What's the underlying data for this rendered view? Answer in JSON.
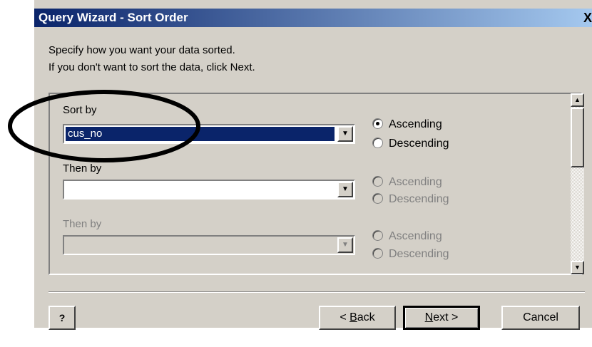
{
  "window": {
    "title": "Query Wizard - Sort Order",
    "close_label": "X"
  },
  "instructions": [
    "Specify how you want your data sorted.",
    "If you don't want to sort the data, click Next."
  ],
  "sort_rows": [
    {
      "label": "Sort by",
      "value": "cus_no",
      "enabled": true,
      "ascending": "Ascending",
      "descending": "Descending",
      "selected": "ascending"
    },
    {
      "label": "Then by",
      "value": "",
      "enabled": true,
      "ascending": "Ascending",
      "descending": "Descending",
      "selected": "none"
    },
    {
      "label": "Then by",
      "value": "",
      "enabled": false,
      "ascending": "Ascending",
      "descending": "Descending",
      "selected": "none"
    }
  ],
  "buttons": {
    "help": "?",
    "back_prefix": "< ",
    "back_u": "B",
    "back_rest": "ack",
    "next_u": "N",
    "next_rest": "ext >",
    "cancel": "Cancel"
  },
  "icons": {
    "dropdown": "chevron-down-icon",
    "scroll_up": "arrow-up-icon",
    "scroll_down": "arrow-down-icon",
    "annotation": "ellipse-highlight"
  }
}
